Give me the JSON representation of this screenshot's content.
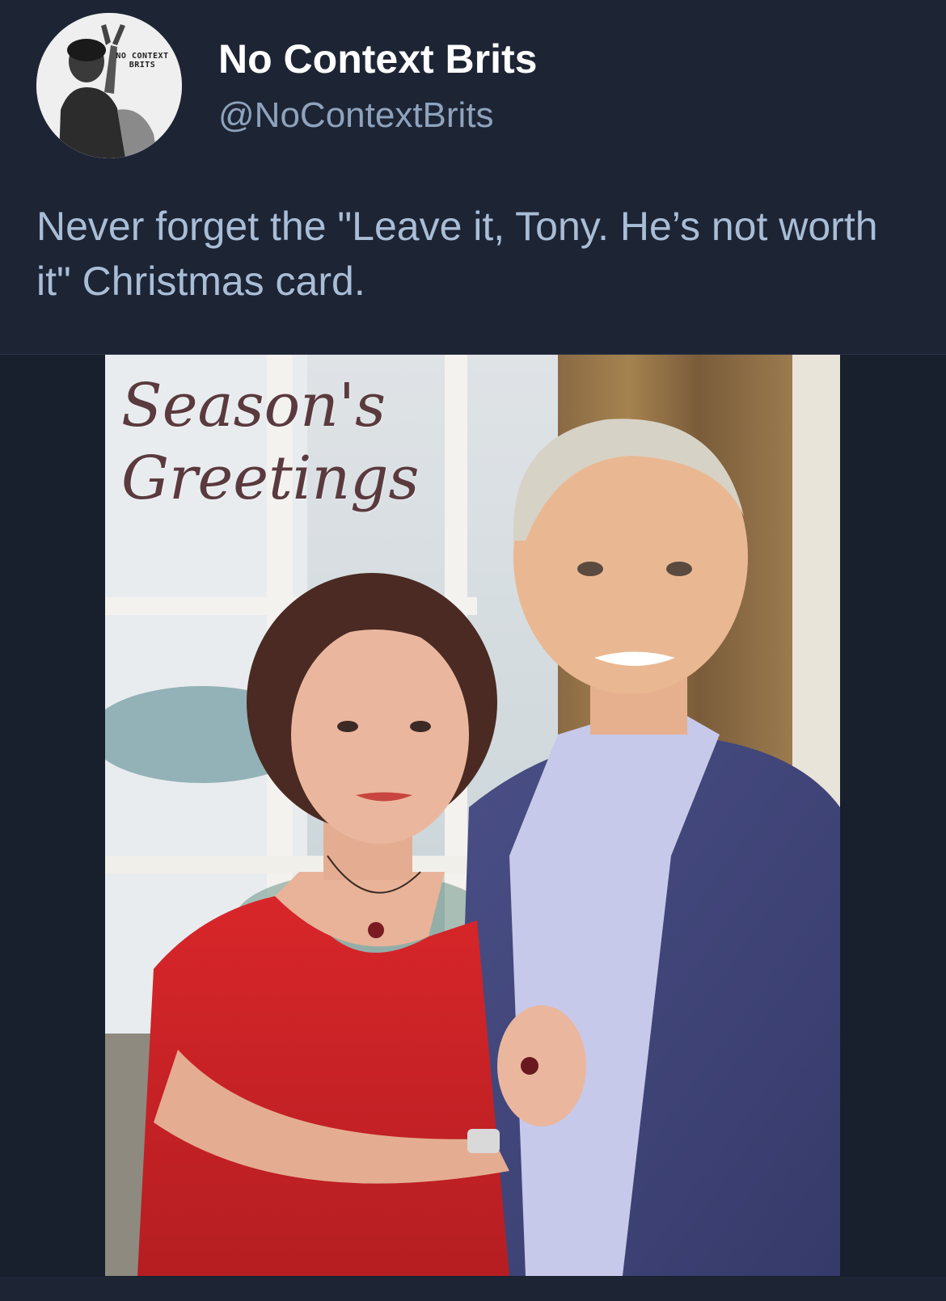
{
  "account": {
    "display_name": "No Context Brits",
    "handle": "@NoContextBrits",
    "avatar_text": "NO CONTEXT BRITS",
    "avatar_icon": "avatar-image"
  },
  "tweet": {
    "text": "Never forget the \"Leave it, Tony. He’s not worth it\" Christmas card."
  },
  "media": {
    "greeting_line1": "Season's",
    "greeting_line2": "Greetings"
  },
  "colors": {
    "background": "#1d2535",
    "display_name": "#ffffff",
    "handle": "#8fa3bd",
    "tweet_text": "#a9bdd6"
  }
}
